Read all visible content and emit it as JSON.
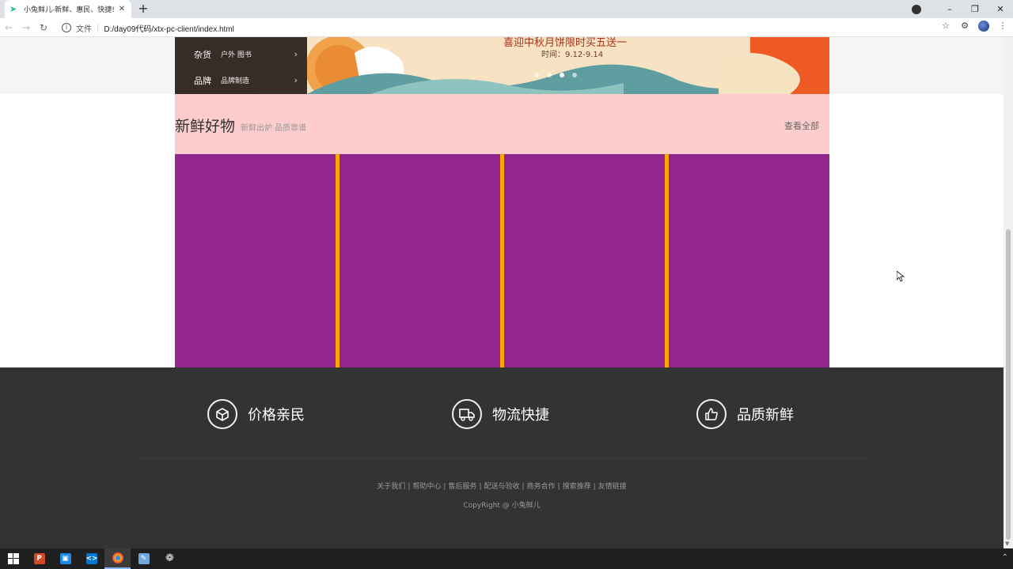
{
  "browser": {
    "tab_title": "小兔鲜儿-新鲜、惠民、快捷!",
    "tab_close": "✕",
    "new_tab": "+",
    "scheme_label": "文件",
    "url": "D:/day09代码/xtx-pc-client/index.html",
    "window_controls": [
      "–",
      "❐",
      "✕"
    ]
  },
  "category_menu": [
    {
      "main": "杂货",
      "sub": "户外 图书",
      "arrow": "›"
    },
    {
      "main": "品牌",
      "sub": "品牌制造",
      "arrow": "›"
    }
  ],
  "banner": {
    "headline": "喜迎中秋月饼限时买五送一",
    "time": "时间：9.12-9.14",
    "slide_count": 4,
    "active_slide": 3
  },
  "fresh_goods": {
    "title": "新鲜好物",
    "subtitle": "新鲜出炉 品质靠谱",
    "more_link": "查看全部",
    "card_count": 4
  },
  "footer": {
    "promises": [
      {
        "label": "价格亲民",
        "icon": "price-box-icon"
      },
      {
        "label": "物流快捷",
        "icon": "delivery-truck-icon"
      },
      {
        "label": "品质新鲜",
        "icon": "thumbs-up-icon"
      }
    ],
    "links": [
      "关于我们",
      "帮助中心",
      "售后服务",
      "配送与验收",
      "商务合作",
      "搜索推荐",
      "友情链接"
    ],
    "copyright": "CopyRight @ 小兔鲜儿"
  },
  "colors": {
    "fresh_head_bg": "#fccdcc",
    "goods_gap": "#ffa500",
    "goods_card": "#93268c",
    "footer_bg": "#333333"
  },
  "taskbar": {
    "apps": [
      "windows-start-icon",
      "powerpoint-icon",
      "file-manager-icon",
      "vscode-icon",
      "chrome-icon",
      "typora-icon",
      "settings-icon"
    ]
  }
}
